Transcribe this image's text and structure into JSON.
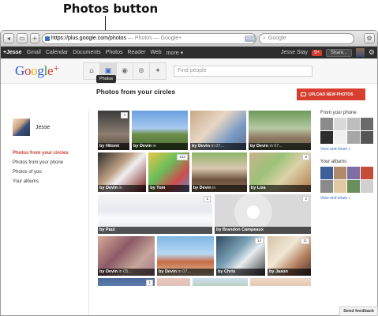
{
  "callout": {
    "label": "Photos button"
  },
  "browser": {
    "url_domain": "https://plus.google.com/photos",
    "url_rest": " — Photos — Google+",
    "rss_label": "RSS",
    "search_placeholder": "Google",
    "back_label": "◂",
    "add_label": "+"
  },
  "gbar": {
    "items": [
      "+Jesse",
      "Gmail",
      "Calendar",
      "Documents",
      "Photos",
      "Reader",
      "Web",
      "more ▾"
    ],
    "user_name": "Jesse Stay",
    "notifications": "9+",
    "share_label": "Share..."
  },
  "header": {
    "logo": [
      "G",
      "o",
      "o",
      "g",
      "l",
      "e",
      "+"
    ],
    "nav_icons": [
      "home-icon",
      "photos-icon",
      "profile-icon",
      "circles-icon",
      "games-icon"
    ],
    "tooltip": "Photos",
    "find_people_placeholder": "Find people"
  },
  "sidebar": {
    "name": "Jesse",
    "links": [
      "Photos from your circles",
      "Photos from your phone",
      "Photos of you",
      "Your albums"
    ]
  },
  "main": {
    "title": "Photos from your circles",
    "upload_label": "UPLOAD NEW PHOTOS",
    "rows": [
      [
        {
          "by": "by Hitomi",
          "in": "",
          "badge": "2",
          "w": 40,
          "bg": "linear-gradient(#3a3a3a,#8c7f71 60%,#4a4038)"
        },
        {
          "by": "by Devin",
          "in": "in ",
          "badge": "",
          "w": 71,
          "bg": "linear-gradient(#6aa0df,#a9c9ee 45%,#6d8f4a 60%,#4b6b34)"
        },
        {
          "by": "by Devin",
          "in": "in 07...",
          "badge": "",
          "w": 71,
          "bg": "linear-gradient(135deg,#c7a98a,#e8d6c3 40%,#7b9bc4 70%,#5b6f90)"
        },
        {
          "by": "by Devin",
          "in": "in 07...",
          "badge": "",
          "w": 79,
          "bg": "linear-gradient(#6d9a5a,#b6c9a3 45%,#8e7662 70%,#5a6a4a)"
        }
      ],
      [
        {
          "by": "by Devin",
          "in": "in ",
          "badge": "",
          "w": 62,
          "bg": "linear-gradient(135deg,#2c2c2c,#bfa085 40%,#f0f0f0 55%,#7a2020)"
        },
        {
          "by": "by Tom",
          "in": "",
          "badge": "103",
          "w": 52,
          "bg": "linear-gradient(135deg,#e9c54a,#6abf5b 40%,#cc4e4e 70%,#6a8ac9)"
        },
        {
          "by": "by Devin",
          "in": "in ",
          "badge": "",
          "w": 71,
          "bg": "linear-gradient(#8fb36a,#d8c7b0 40%,#6b4f3a 70%,#8f7a60)"
        },
        {
          "by": "by Liza",
          "in": "",
          "badge": "8",
          "w": 79,
          "bg": "linear-gradient(135deg,#c9b28a,#9cc27a 35%,#dcd2a8 60%,#b07a4a)"
        }
      ],
      [
        {
          "by": "by Paul",
          "in": "",
          "badge": "5",
          "w": 145,
          "bg": "linear-gradient(#f4f4f4,#e6e9ef 40%,#fafafa 60%,#dfe3ea)"
        },
        {
          "by": "by Brandon Campeaux",
          "in": "",
          "badge": "2",
          "w": 122,
          "bg": "radial-gradient(circle at 40% 45%,#ffffff 0 10%,#e8e8e8 11% 30%,#d9d9d9 31%),linear-gradient(#cfcfcf,#bdbdbd)"
        }
      ],
      [
        {
          "by": "by Devin",
          "in": "in 05...",
          "badge": "",
          "w": 72,
          "bg": "linear-gradient(135deg,#d8a99a,#8b5a66 40%,#c7a69b 70%,#a3768a)"
        },
        {
          "by": "by Devin",
          "in": "in 07...",
          "badge": "",
          "w": 72,
          "bg": "linear-gradient(#7fb7e6,#b9d8f1 45%,#c86a45 65%,#d8c7a6)"
        },
        {
          "by": "by Chris",
          "in": "",
          "badge": "14",
          "w": 62,
          "bg": "linear-gradient(135deg,#2f4a5f,#7ba0b5 40%,#e7ecef 60%,#3a3a3a)"
        },
        {
          "by": "by Jason",
          "in": "",
          "badge": "11",
          "w": 55,
          "bg": "linear-gradient(135deg,#d3c2a8,#f1e7d5 40%,#b07a5a 70%,#4a3a30)"
        }
      ],
      [
        {
          "by": "",
          "in": "",
          "badge": "1",
          "w": 72,
          "bg": "linear-gradient(#4a6a9a,#7b98c4 50%,#3a4f7a)"
        },
        {
          "by": "",
          "in": "",
          "badge": "",
          "w": 42,
          "bg": "linear-gradient(#e9c8c0,#c49a8f)"
        },
        {
          "by": "",
          "in": "",
          "badge": "",
          "w": 70,
          "bg": "linear-gradient(#cfe0f0,#8fb36a 60%,#5a7a3a)"
        },
        {
          "by": "",
          "in": "",
          "badge": "",
          "w": 77,
          "bg": "linear-gradient(#f0d8c8,#b98a72)"
        }
      ]
    ]
  },
  "rightcol": {
    "phone_title": "From your phone",
    "phone_thumbs": [
      "#8a8a8a",
      "#d9d9d9",
      "#bdbdbd",
      "#6a6a6a",
      "#2d2d2d",
      "#f0f0f0",
      "#a7a7a7",
      "#555555"
    ],
    "phone_link": "View and share »",
    "albums_title": "Your albums",
    "album_thumbs": [
      "#3f5f9a",
      "#b08a6a",
      "#7d6fa3",
      "#c44d3a",
      "#8a8a8a",
      "#e1c7a2",
      "#6a8f5a",
      "#d0d0d0"
    ],
    "albums_link": "View and share »",
    "feedback": "Send feedback"
  }
}
